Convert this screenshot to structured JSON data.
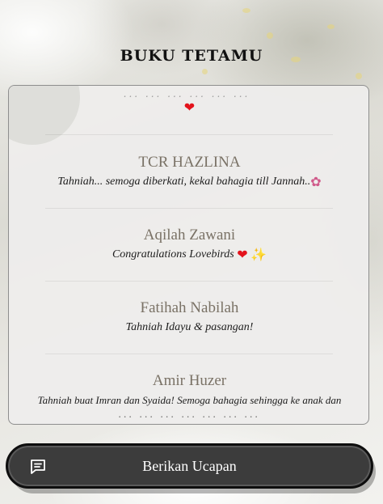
{
  "header": {
    "title": "BUKU TETAMU"
  },
  "guestbook": {
    "cut_entry": {
      "message_fragment": "... ... ... ... ... ...",
      "emoji": "❤"
    },
    "entries": [
      {
        "name": "TCR HAZLINA",
        "message": "Tahniah... semoga diberkati, kekal bahagia till Jannah..",
        "emoji": "✿"
      },
      {
        "name": "Aqilah Zawani",
        "message": "Congratulations Lovebirds",
        "emoji": "❤",
        "emoji2": "✨"
      },
      {
        "name": "Fatihah Nabilah",
        "message": "Tahniah Idayu & pasangan!"
      },
      {
        "name": "Amir Huzer",
        "message": "Tahniah buat Imran dan Syaida! Semoga bahagia sehingga ke anak dan",
        "message_cut": "... ... ... ... ... ... ..."
      }
    ]
  },
  "action": {
    "label": "Berikan Ucapan",
    "icon": "message-icon"
  },
  "colors": {
    "button_bg": "#3c3c3c",
    "name_text": "#7a7266",
    "heart": "#e3131c"
  }
}
